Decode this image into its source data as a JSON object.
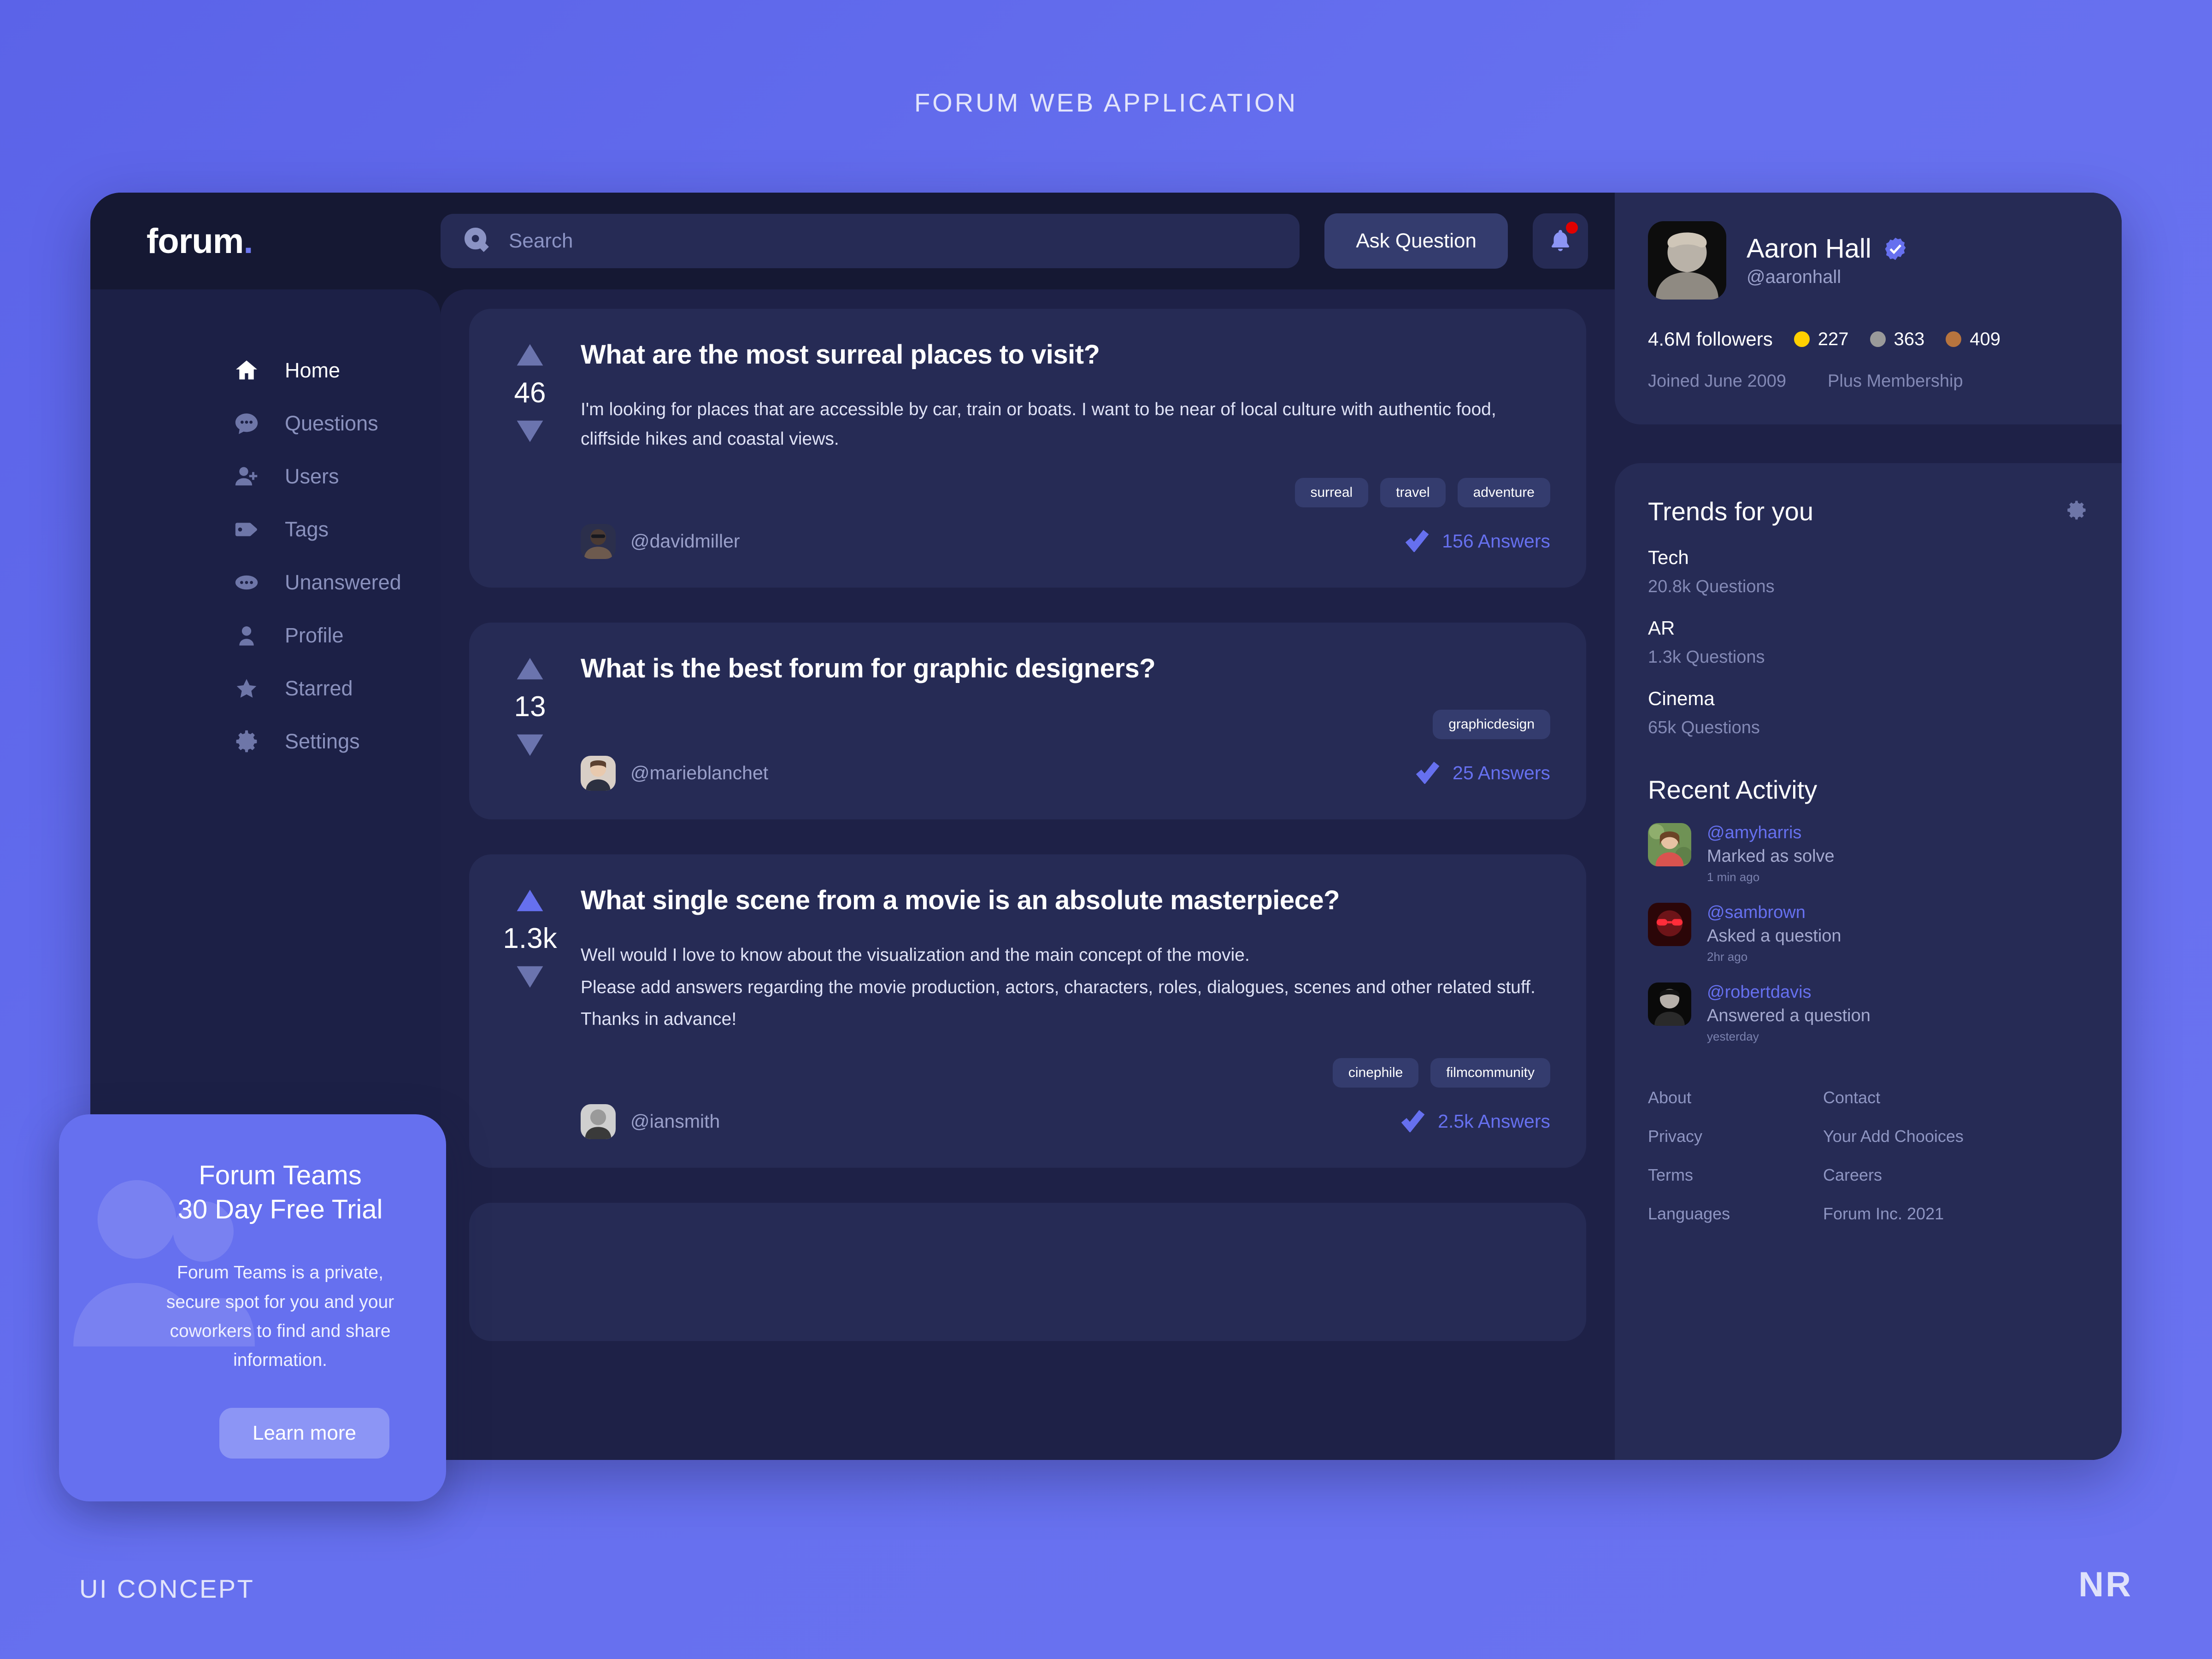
{
  "poster": {
    "title": "FORUM WEB APPLICATION",
    "caption_left": "UI CONCEPT",
    "caption_right": "NR"
  },
  "brand": {
    "name": "forum",
    "dot": "."
  },
  "topbar": {
    "search_placeholder": "Search",
    "search_value": "",
    "search_icon": "search-icon",
    "ask_label": "Ask Question",
    "bell_icon": "bell-icon",
    "has_notification": true
  },
  "sidebar": {
    "items": [
      {
        "label": "Home",
        "icon": "home-icon",
        "active": true
      },
      {
        "label": "Questions",
        "icon": "chat-bubble-icon",
        "active": false
      },
      {
        "label": "Users",
        "icon": "user-add-icon",
        "active": false
      },
      {
        "label": "Tags",
        "icon": "tag-icon",
        "active": false
      },
      {
        "label": "Unanswered",
        "icon": "ellipsis-icon",
        "active": false
      },
      {
        "label": "Profile",
        "icon": "person-icon",
        "active": false
      },
      {
        "label": "Starred",
        "icon": "star-icon",
        "active": false
      },
      {
        "label": "Settings",
        "icon": "gear-icon",
        "active": false
      }
    ]
  },
  "promo": {
    "title_line1": "Forum Teams",
    "title_line2": "30 Day Free Trial",
    "body": "Forum Teams is a private, secure spot for you and your coworkers to find and share information.",
    "button_label": "Learn more",
    "ghost_icon": "people-icon"
  },
  "feed": {
    "questions": [
      {
        "votes": "46",
        "vote_hot": false,
        "title": "What are the most surreal places to visit?",
        "paragraphs": [
          "I'm looking for places that are accessible by car, train or boats. I want to be near of local culture with authentic food, cliffside hikes and coastal views."
        ],
        "tags": [
          "surreal",
          "travel",
          "adventure"
        ],
        "author": "@davidmiller",
        "answers": "156 Answers",
        "answers_icon": "check-icon"
      },
      {
        "votes": "13",
        "vote_hot": false,
        "title": "What is the best forum for graphic designers?",
        "paragraphs": [],
        "tags": [
          "graphicdesign"
        ],
        "author": "@marieblanchet",
        "answers": "25 Answers",
        "answers_icon": "check-icon"
      },
      {
        "votes": "1.3k",
        "vote_hot": true,
        "title": "What single scene from a movie is an absolute masterpiece?",
        "paragraphs": [
          "Well would I love to know about the visualization and the main concept of the movie.",
          "Please add answers regarding the movie production, actors, characters, roles, dialogues, scenes and other related stuff.",
          "Thanks in advance!"
        ],
        "tags": [
          "cinephile",
          "filmcommunity"
        ],
        "author": "@iansmith",
        "answers": "2.5k Answers",
        "answers_icon": "check-icon"
      }
    ]
  },
  "profile": {
    "name": "Aaron Hall",
    "handle": "@aaronhall",
    "verified_icon": "verified-badge-icon",
    "followers": "4.6M followers",
    "badges": [
      {
        "color": "#ffd000",
        "count": "227",
        "name": "gold-badge"
      },
      {
        "color": "#9a9a9a",
        "count": "363",
        "name": "silver-badge"
      },
      {
        "color": "#b7743e",
        "count": "409",
        "name": "bronze-badge"
      }
    ],
    "joined": "Joined June 2009",
    "membership": "Plus Membership"
  },
  "trends": {
    "title": "Trends for you",
    "gear_icon": "gear-icon",
    "items": [
      {
        "name": "Tech",
        "count": "20.8k Questions"
      },
      {
        "name": "AR",
        "count": "1.3k Questions"
      },
      {
        "name": "Cinema",
        "count": "65k Questions"
      }
    ]
  },
  "activity": {
    "title": "Recent Activity",
    "items": [
      {
        "handle": "@amyharris",
        "text": "Marked as solve",
        "time": "1 min ago"
      },
      {
        "handle": "@sambrown",
        "text": "Asked a question",
        "time": "2hr ago"
      },
      {
        "handle": "@robertdavis",
        "text": "Answered a question",
        "time": "yesterday"
      }
    ]
  },
  "footer": {
    "col1": [
      "About",
      "Privacy",
      "Terms",
      "Languages"
    ],
    "col2": [
      "Contact",
      "Your Add Chooices",
      "Careers",
      "Forum Inc. 2021"
    ]
  },
  "colors": {
    "brand_accent": "#6670ef",
    "page_bg": "#6670ef",
    "app_bg": "#151833",
    "card_bg": "#262b55",
    "feed_bg": "#1e2147",
    "sidebar_bg": "#1c2046",
    "notification_dot": "#e00000"
  }
}
